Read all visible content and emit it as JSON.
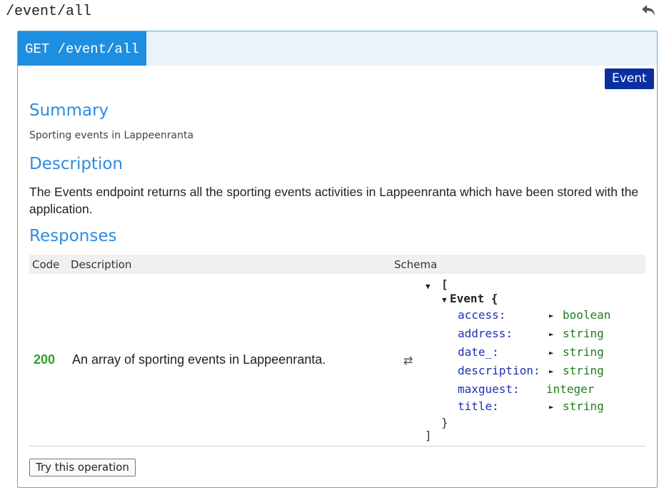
{
  "page": {
    "path_title": "/event/all"
  },
  "operation": {
    "method_path": "GET /event/all",
    "tag": "Event"
  },
  "summary": {
    "heading": "Summary",
    "text": "Sporting events in Lappeenranta"
  },
  "description": {
    "heading": "Description",
    "text": "The Events endpoint returns all the sporting events activities in Lappeenranta which have been stored with the application."
  },
  "responses": {
    "heading": "Responses",
    "columns": {
      "code": "Code",
      "description": "Description",
      "schema": "Schema"
    },
    "rows": [
      {
        "code": "200",
        "description": "An array of sporting events in Lappeenranta."
      }
    ]
  },
  "schema": {
    "open_bracket": "[",
    "model_name": "Event {",
    "fields": [
      {
        "name": "access:",
        "type": "boolean",
        "expandable": true
      },
      {
        "name": "address:",
        "type": "string",
        "expandable": true
      },
      {
        "name": "date_:",
        "type": "string",
        "expandable": true
      },
      {
        "name": "description:",
        "type": "string",
        "expandable": true
      },
      {
        "name": "maxguest:",
        "type": "integer",
        "expandable": false
      },
      {
        "name": "title:",
        "type": "string",
        "expandable": true
      }
    ],
    "close_brace": "}",
    "close_bracket": "]"
  },
  "actions": {
    "try_label": "Try this operation"
  },
  "colors": {
    "accent": "#2d8ce0",
    "method_badge": "#1e8fe0",
    "tag_badge": "#0b2fa0",
    "success": "#2ea12e"
  },
  "icons": {
    "back": "back-arrow-icon",
    "swap": "swap-icon"
  }
}
